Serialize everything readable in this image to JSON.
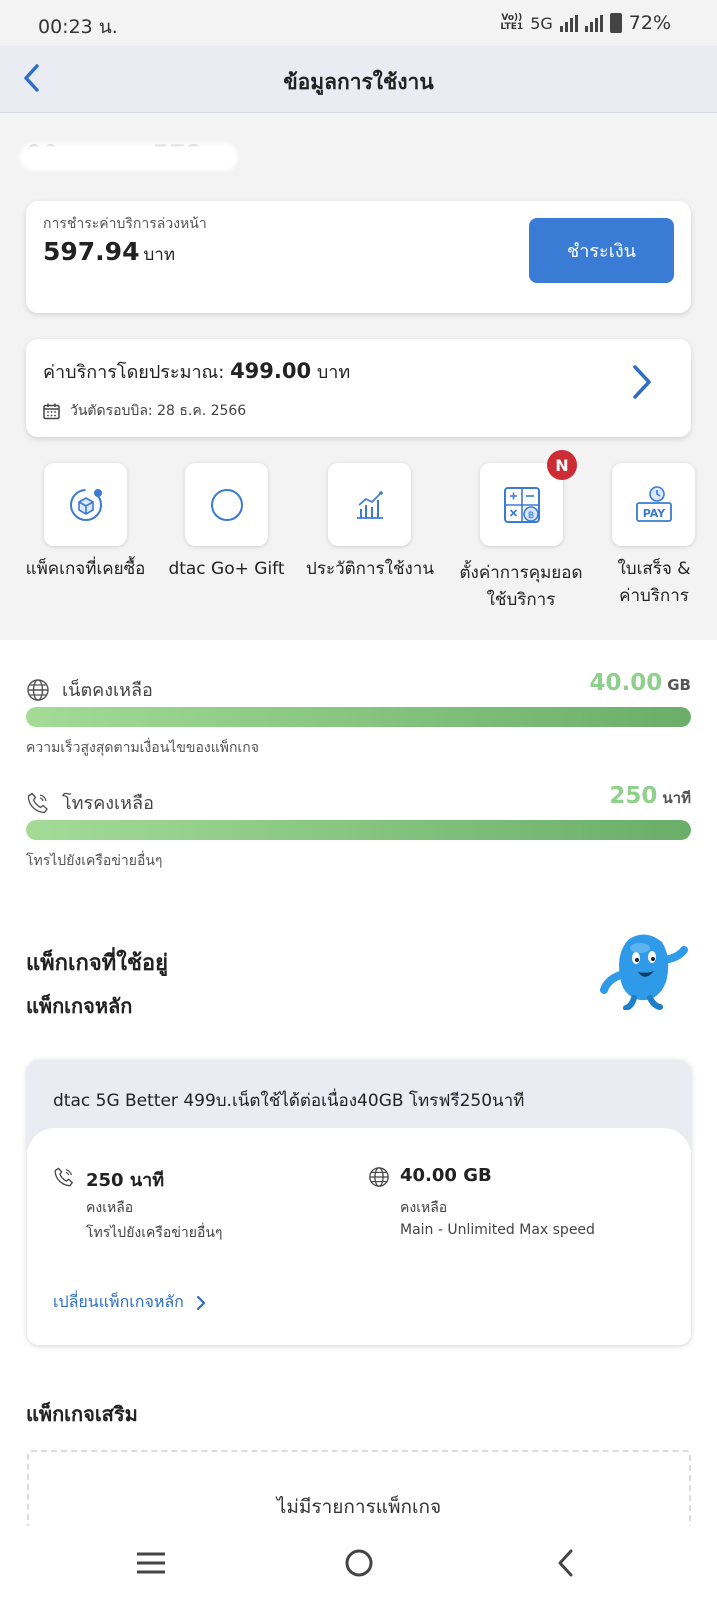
{
  "status_bar": {
    "time": "00:23 น.",
    "volte": "Vo))",
    "lte": "LTE1",
    "network": "5G",
    "battery": "72%"
  },
  "header": {
    "title": "ข้อมูลการใช้งาน"
  },
  "phone_number": "09xxxxxx573",
  "payment": {
    "label": "การชำระค่าบริการล่วงหน้า",
    "amount": "597.94",
    "unit": "บาท",
    "button": "ชำระเงิน"
  },
  "estimate": {
    "label": "ค่าบริการโดยประมาณ:",
    "amount": "499.00",
    "unit": "บาท",
    "bill_cycle": "วันตัดรอบบิล: 28 ธ.ค. 2566"
  },
  "quick_actions": [
    {
      "line1": "แพ็คเกจที่เคยซื้อ",
      "line2": "",
      "icon": "package-history-icon"
    },
    {
      "line1": "dtac Go+ Gift",
      "line2": "",
      "icon": "gift-circle-icon"
    },
    {
      "line1": "ประวัติการใช้งาน",
      "line2": "",
      "icon": "usage-chart-icon"
    },
    {
      "line1": "ตั้งค่าการคุมยอด",
      "line2": "ใช้บริการ",
      "icon": "calculator-icon",
      "badge": "N"
    },
    {
      "line1": "ใบเสร็จ &",
      "line2": "ค่าบริการ",
      "icon": "pay-receipt-icon"
    }
  ],
  "balance": {
    "data": {
      "label": "เน็ตคงเหลือ",
      "value": "40.00",
      "unit": "GB",
      "note": "ความเร็วสูงสุดตามเงื่อนไขของแพ็กเกจ",
      "fill": 1.0
    },
    "voice": {
      "label": "โทรคงเหลือ",
      "value": "250",
      "unit": "นาที",
      "note": "โทรไปยังเครือข่ายอื่นๆ",
      "fill": 1.0
    },
    "bar_color": "#8fd18c"
  },
  "packages": {
    "title": "แพ็กเกจที่ใช้อยู่",
    "main_title": "แพ็กเกจหลัก",
    "main": {
      "name": "dtac 5G Better 499บ.เน็ตใช้ได้ต่อเนื่อง40GB โทรฟรี250นาที",
      "voice_value": "250 นาที",
      "voice_remain": "คงเหลือ",
      "voice_note": "โทรไปยังเครือข่ายอื่นๆ",
      "data_value": "40.00 GB",
      "data_remain": "คงเหลือ",
      "data_note": "Main - Unlimited Max speed",
      "change_link": "เปลี่ยนแพ็กเกจหลัก"
    },
    "addon_title": "แพ็กเกจเสริม",
    "addon_empty": "ไม่มีรายการแพ็กเกจ"
  },
  "colors": {
    "accent": "#3a7bd5",
    "header_bg": "#e9edf3",
    "badge": "#cc2c36"
  }
}
